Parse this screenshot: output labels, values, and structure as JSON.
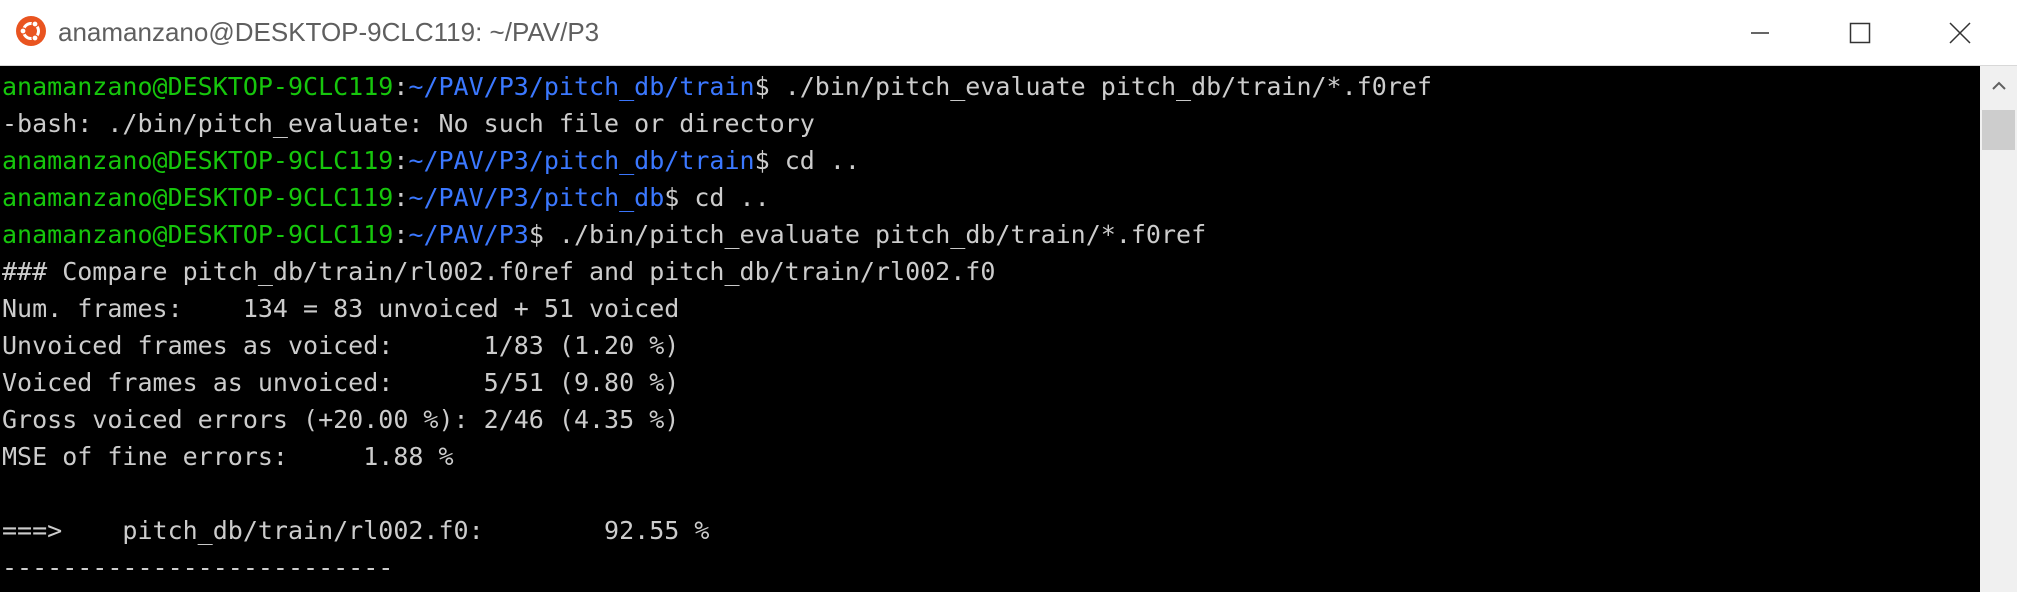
{
  "window": {
    "title": "anamanzano@DESKTOP-9CLC119: ~/PAV/P3",
    "icon": "ubuntu-icon",
    "controls": [
      "minimize-icon",
      "maximize-icon",
      "close-icon"
    ]
  },
  "colors": {
    "user": "#16c60c",
    "path": "#3b78ff",
    "text": "#cccccc",
    "background": "#000000"
  },
  "terminal": {
    "lines": [
      {
        "user": "anamanzano@DESKTOP-9CLC119",
        "sep": ":",
        "path": "~/PAV/P3/pitch_db/train",
        "cmd": "$ ./bin/pitch_evaluate pitch_db/train/*.f0ref"
      },
      {
        "text": "-bash: ./bin/pitch_evaluate: No such file or directory"
      },
      {
        "user": "anamanzano@DESKTOP-9CLC119",
        "sep": ":",
        "path": "~/PAV/P3/pitch_db/train",
        "cmd": "$ cd .."
      },
      {
        "user": "anamanzano@DESKTOP-9CLC119",
        "sep": ":",
        "path": "~/PAV/P3/pitch_db",
        "cmd": "$ cd .."
      },
      {
        "user": "anamanzano@DESKTOP-9CLC119",
        "sep": ":",
        "path": "~/PAV/P3",
        "cmd": "$ ./bin/pitch_evaluate pitch_db/train/*.f0ref"
      },
      {
        "text": "### Compare pitch_db/train/rl002.f0ref and pitch_db/train/rl002.f0"
      },
      {
        "text": "Num. frames:    134 = 83 unvoiced + 51 voiced"
      },
      {
        "text": "Unvoiced frames as voiced:      1/83 (1.20 %)"
      },
      {
        "text": "Voiced frames as unvoiced:      5/51 (9.80 %)"
      },
      {
        "text": "Gross voiced errors (+20.00 %): 2/46 (4.35 %)"
      },
      {
        "text": "MSE of fine errors:     1.88 %"
      },
      {
        "text": ""
      },
      {
        "text": "===>    pitch_db/train/rl002.f0:        92.55 %"
      },
      {
        "text": "--------------------------"
      }
    ]
  }
}
